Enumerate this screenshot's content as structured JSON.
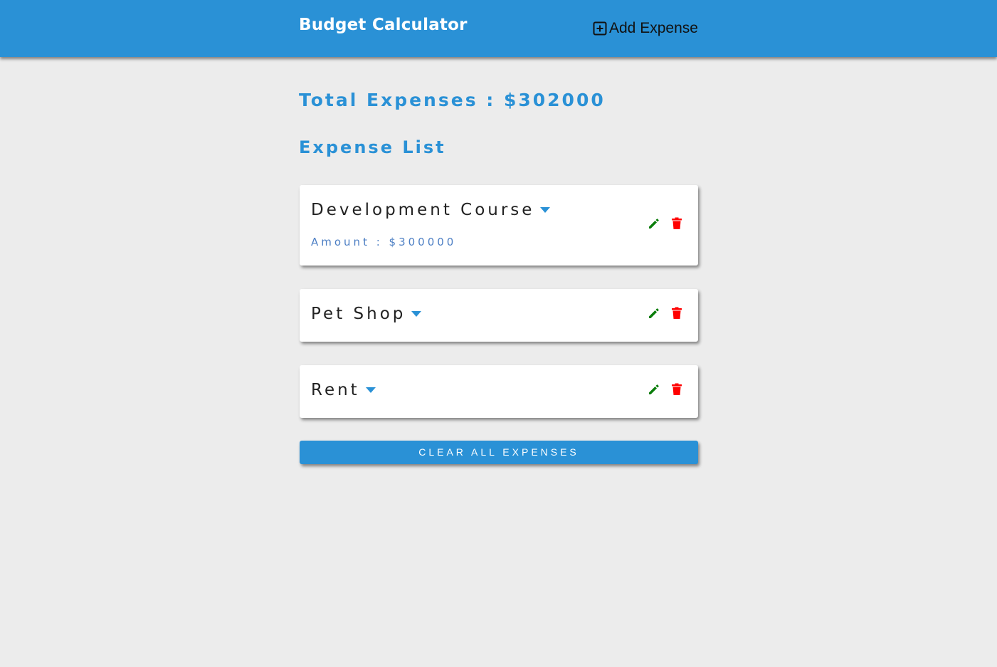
{
  "navbar": {
    "title": "Budget Calculator",
    "add_label": "Add Expense",
    "bg_color": "#2a91d6"
  },
  "summary": {
    "total_text": "Total Expenses : $302000",
    "list_title": "Expense List"
  },
  "expenses": [
    {
      "name": "Development Course",
      "amount_text": "Amount : $300000",
      "expanded": true
    },
    {
      "name": "Pet Shop",
      "expanded": false
    },
    {
      "name": "Rent",
      "expanded": false
    }
  ],
  "icons": {
    "add": "plus-square-icon",
    "expand": "caret-down-icon",
    "edit": "pencil-icon",
    "delete": "trash-icon"
  },
  "colors": {
    "accent": "#2a91d6",
    "edit": "#0a7d0a",
    "delete": "#ff0000",
    "background": "#ececec"
  },
  "clear_button": {
    "label": "CLEAR ALL EXPENSES"
  }
}
